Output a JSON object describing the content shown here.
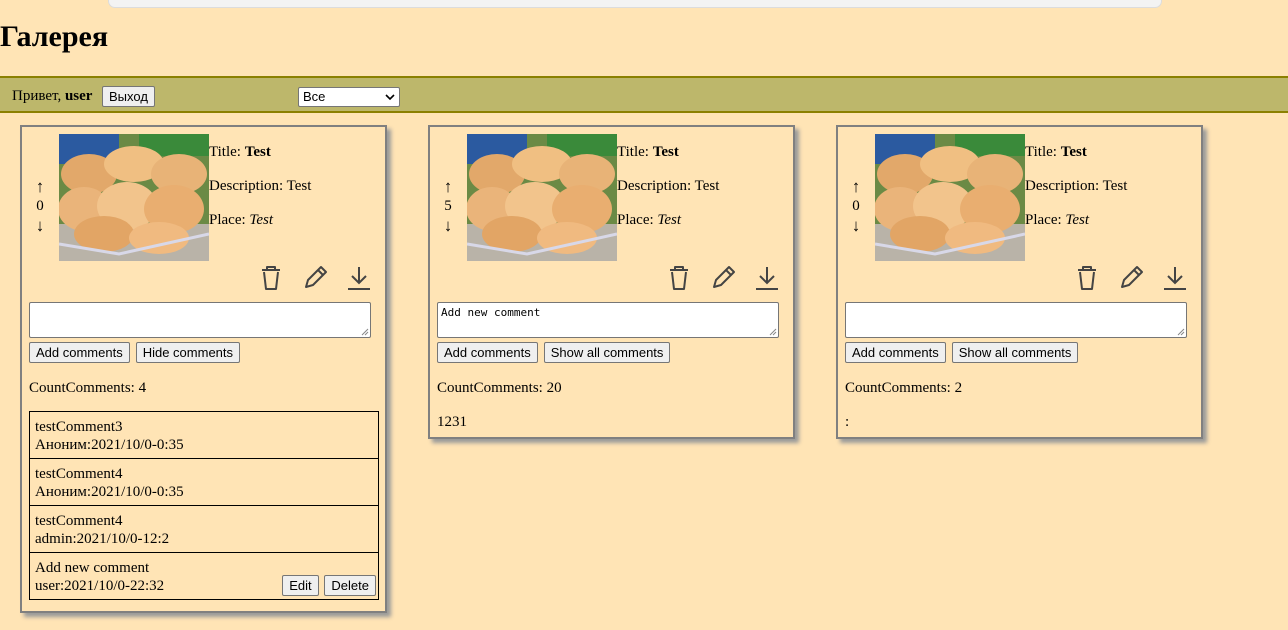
{
  "page": {
    "title": "Галерея"
  },
  "header": {
    "greeting_prefix": "Привет,",
    "username": "user",
    "logout_label": "Выход",
    "filter_value": "Все"
  },
  "cards": [
    {
      "votes": "0",
      "title_label": "Title:",
      "title": "Test",
      "description_label": "Description:",
      "description": "Test",
      "place_label": "Place:",
      "place": "Test",
      "comment_input_value": "",
      "add_label": "Add comments",
      "toggle_label": "Hide comments",
      "count_label": "CountComments:",
      "count": "4",
      "comments": [
        {
          "text": "testComment3",
          "meta": "Аноним:2021/10/0-0:35"
        },
        {
          "text": "testComment4",
          "meta": "Аноним:2021/10/0-0:35"
        },
        {
          "text": "testComment4",
          "meta": "admin:2021/10/0-12:2"
        },
        {
          "text": "Add new comment",
          "meta": "user:2021/10/0-22:32",
          "edit_label": "Edit",
          "delete_label": "Delete"
        }
      ]
    },
    {
      "votes": "5",
      "title_label": "Title:",
      "title": "Test",
      "description_label": "Description:",
      "description": "Test",
      "place_label": "Place:",
      "place": "Test",
      "comment_input_value": "Add new comment",
      "add_label": "Add comments",
      "toggle_label": "Show all comments",
      "count_label": "CountComments:",
      "count": "20",
      "last_comment": "1231"
    },
    {
      "votes": "0",
      "title_label": "Title:",
      "title": "Test",
      "description_label": "Description:",
      "description": "Test",
      "place_label": "Place:",
      "place": "Test",
      "comment_input_value": "",
      "add_label": "Add comments",
      "toggle_label": "Show all comments",
      "count_label": "CountComments:",
      "count": "2",
      "last_comment": ":"
    }
  ],
  "icons": {
    "vote_up": "↑",
    "vote_down": "↓",
    "delete": "trash-icon",
    "edit": "pencil-icon",
    "download": "download-icon"
  }
}
